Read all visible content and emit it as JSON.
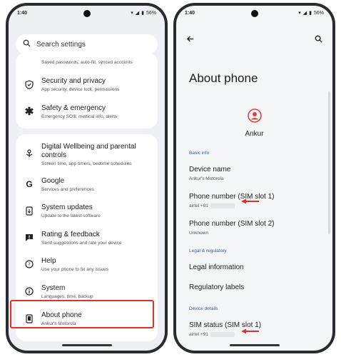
{
  "left_phone": {
    "status": {
      "time": "1:40",
      "battery": "56%"
    },
    "search": {
      "placeholder": "Search settings"
    },
    "partial_item": {
      "subtitle": "Saved passwords, auto-fill, synced accounts"
    },
    "items": [
      {
        "title": "Security and privacy",
        "subtitle": "App security, device lock, permissions",
        "icon": "shield-icon"
      },
      {
        "title": "Safety & emergency",
        "subtitle": "Emergency SOS, medical info, alerts",
        "icon": "asterisk-icon"
      },
      {
        "title": "Digital Wellbeing and parental controls",
        "subtitle": "Screen time, app timers, bedtime schedules",
        "icon": "wellbeing-icon"
      },
      {
        "title": "Google",
        "subtitle": "Services and preferences",
        "icon": "google-icon"
      },
      {
        "title": "System updates",
        "subtitle": "Update to the latest software",
        "icon": "system-update-icon"
      },
      {
        "title": "Rating & feedback",
        "subtitle": "Send suggestions and rate your device",
        "icon": "feedback-icon"
      },
      {
        "title": "Help",
        "subtitle": "Use your phone to fix any issues",
        "icon": "help-icon"
      },
      {
        "title": "System",
        "subtitle": "Languages, time, backup",
        "icon": "info-icon"
      },
      {
        "title": "About phone",
        "subtitle": "Ankur's Motorola",
        "icon": "phone-icon"
      }
    ],
    "highlight_color": "#e0312b"
  },
  "right_phone": {
    "status": {
      "time": "1:40",
      "battery": "56%"
    },
    "title": "About phone",
    "user_name": "Ankur",
    "sections": {
      "basic": "Basic info",
      "legal": "Legal & regulatory",
      "device": "Device details"
    },
    "basic_items": [
      {
        "title": "Device name",
        "subtitle": "Ankur's Motorola"
      },
      {
        "title": "Phone number (SIM slot 1)",
        "subtitle": "airtel +91"
      },
      {
        "title": "Phone number (SIM slot 2)",
        "subtitle": "Unknown"
      }
    ],
    "legal_items": [
      {
        "title": "Legal information"
      },
      {
        "title": "Regulatory labels"
      }
    ],
    "device_items": [
      {
        "title": "SIM status (SIM slot 1)",
        "subtitle": "airtel +91"
      }
    ],
    "accent_color": "#2f5aa8",
    "arrow_color": "#e0312b"
  }
}
